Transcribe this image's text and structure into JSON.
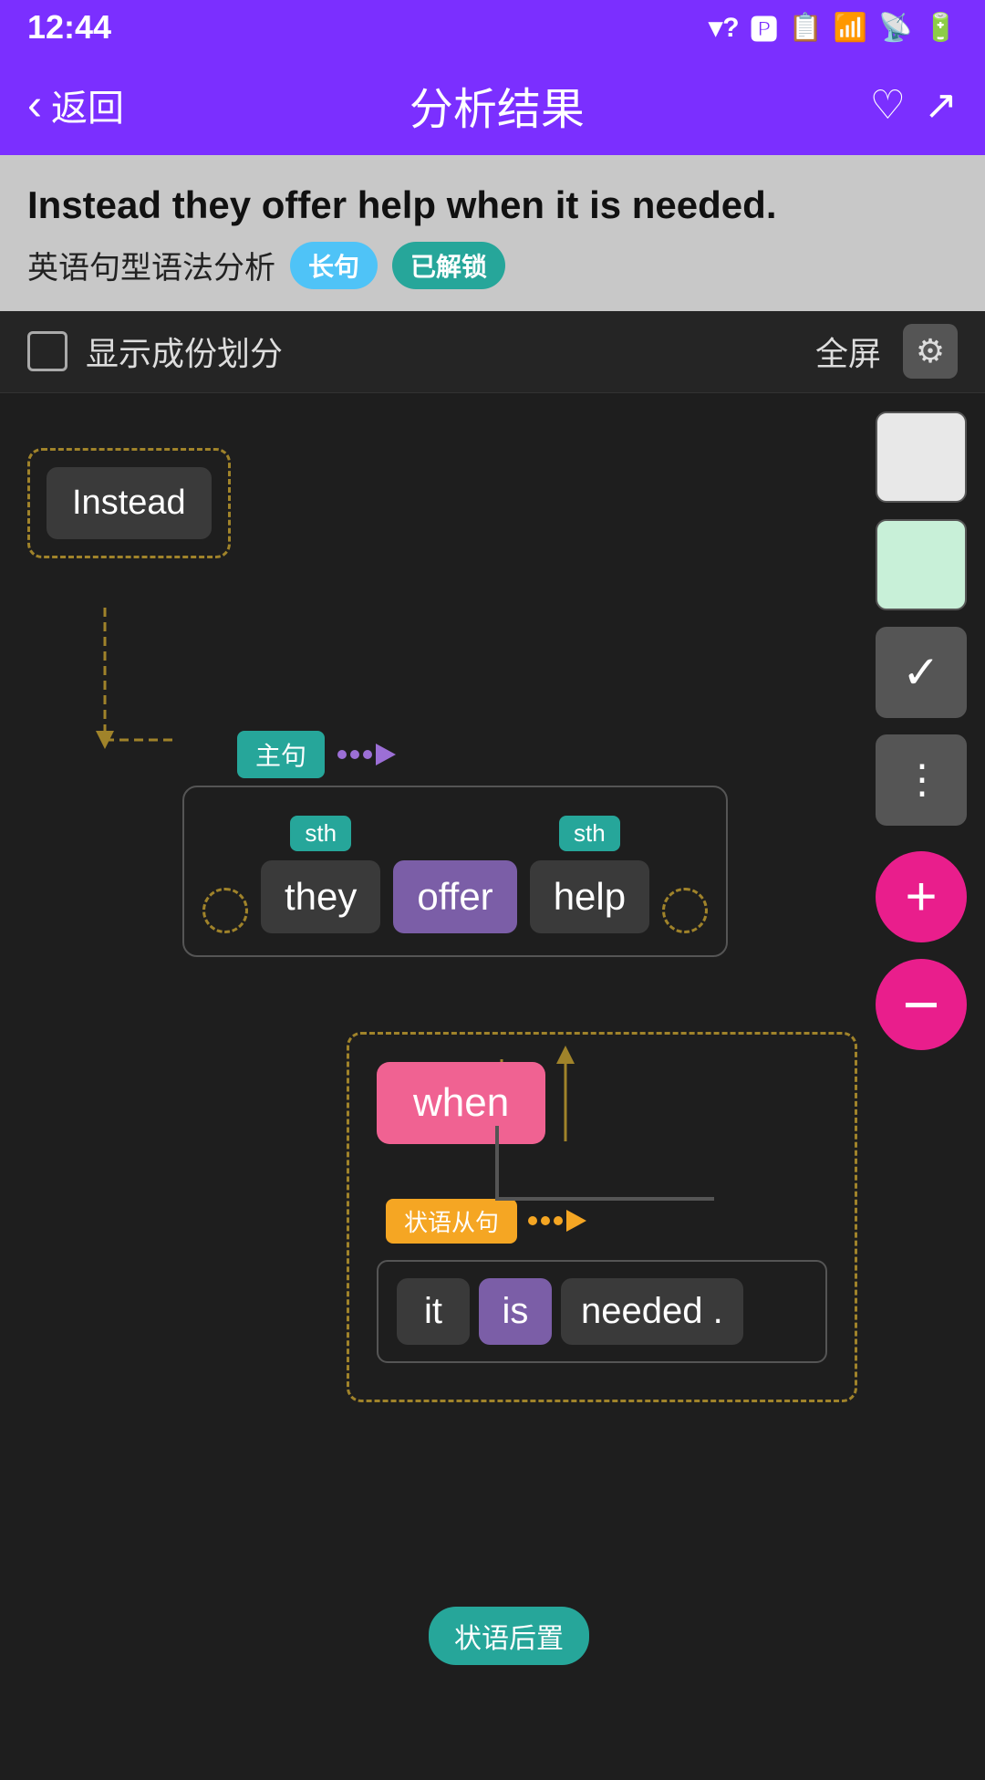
{
  "statusBar": {
    "time": "12:44",
    "icons": [
      "signal-question-icon",
      "parking-icon",
      "sim-icon",
      "wifi-off-icon",
      "signal-icon",
      "battery-icon"
    ]
  },
  "nav": {
    "backLabel": "返回",
    "title": "分析结果",
    "likeIcon": "♡",
    "shareIcon": "↗"
  },
  "sentenceHeader": {
    "sentence": "Instead they offer help when it is needed.",
    "analysisLabel": "英语句型语法分析",
    "badge1": "长句",
    "badge2": "已解锁"
  },
  "controls": {
    "checkboxLabel": "显示成份划分",
    "fullscreenLabel": "全屏",
    "gearIcon": "⚙"
  },
  "diagram": {
    "instead": "Instead",
    "mainClauseTag": "主句",
    "words": {
      "they": "they",
      "offer": "offer",
      "help": "help",
      "sth1": "sth",
      "sth2": "sth"
    },
    "subClause": {
      "whenWord": "when",
      "tag": "状语从句",
      "it": "it",
      "is": "is",
      "needed": "needed .",
      "advTag": "状语后置"
    }
  },
  "palette": {
    "checkmark": "✓",
    "dots": "⋮",
    "plus": "+",
    "minus": "−"
  }
}
